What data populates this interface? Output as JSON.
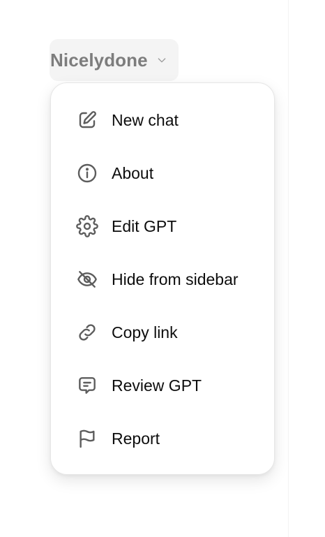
{
  "header": {
    "model_name": "Nicelydone"
  },
  "menu": {
    "items": [
      {
        "label": "New chat",
        "icon": "edit-icon"
      },
      {
        "label": "About",
        "icon": "info-icon"
      },
      {
        "label": "Edit GPT",
        "icon": "gear-icon"
      },
      {
        "label": "Hide from sidebar",
        "icon": "eye-off-icon"
      },
      {
        "label": "Copy link",
        "icon": "link-icon"
      },
      {
        "label": "Review GPT",
        "icon": "message-square-icon"
      },
      {
        "label": "Report",
        "icon": "flag-icon"
      }
    ]
  },
  "colors": {
    "text": "#0d0d0d",
    "icon": "#5d5d5d",
    "muted": "#7d7d7d",
    "switcher_bg": "#f4f4f4",
    "menu_border": "#e6e6e6"
  }
}
